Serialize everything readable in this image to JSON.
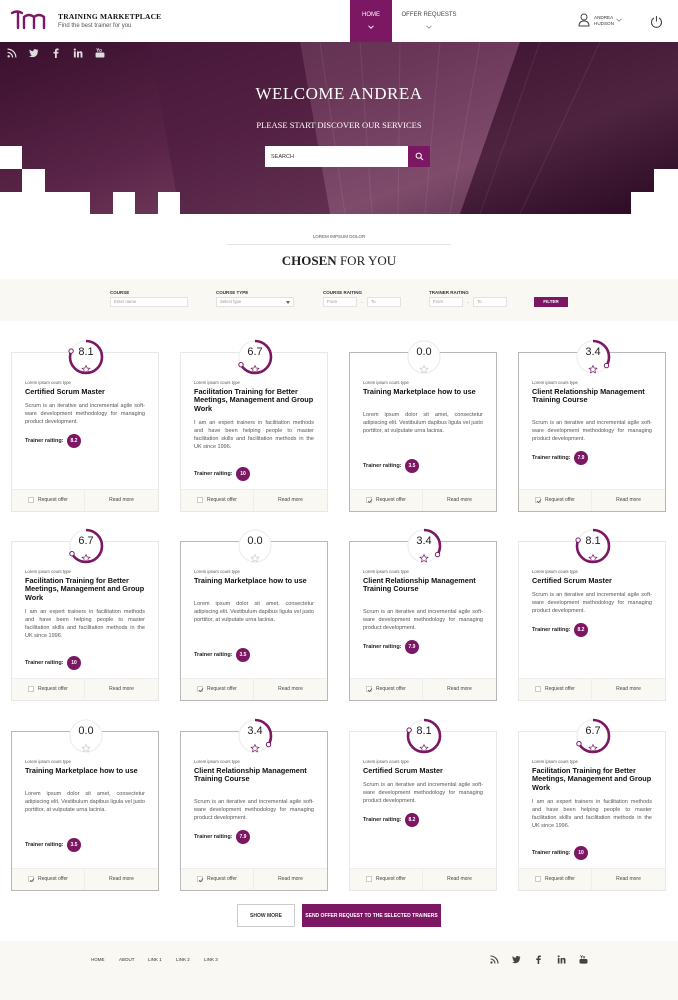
{
  "brand": {
    "title": "TRAINING MARKETPLACE",
    "subtitle": "Find the best trainer for you"
  },
  "nav": {
    "home": "HOME",
    "offers": "OFFER REQUESTS"
  },
  "user": {
    "first": "ANDREA",
    "last": "HUDSON"
  },
  "hero": {
    "welcome": "WELCOME ANDREA",
    "subtitle": "PLEASE START DISCOVER OUR SERVICES",
    "search_placeholder": "SEARCH"
  },
  "section": {
    "kicker": "LOREM IMPSUM DOLOR",
    "title_bold": "CHOSEN",
    "title_rest": " FOR YOU"
  },
  "filter": {
    "course_label": "COURSE",
    "course_placeholder": "Enter name",
    "type_label": "COURSE TYPE",
    "type_placeholder": "Select type",
    "rating_label": "COURSE RAITING",
    "rating_from": "From",
    "rating_to": "To",
    "trainer_label": "TRAINER RAITING",
    "trainer_from": "From",
    "trainer_to": "To",
    "button": "FILTER"
  },
  "card_labels": {
    "type": "Lorem ipsum cours type",
    "trainer": "Trainer raiting:",
    "request": "Request offer",
    "more": "Read more"
  },
  "cards": [
    {
      "score": "8.1",
      "fill": 0.81,
      "title": "Certified Scrum Master",
      "desc": "Scrum is an iterative and incremental agile soft-ware development methodology for managing product development.",
      "trainer": "8.2",
      "checked": false,
      "selected": false
    },
    {
      "score": "6.7",
      "fill": 0.67,
      "title": "Facilitation Training for Better Meetings, Management and Group Work",
      "desc": "I am an expert trainers in facilitation methods and have been helping people to master facilitation skills and facilitation methods in the UK since 1996.",
      "trainer": "10",
      "checked": false,
      "selected": false
    },
    {
      "score": "0.0",
      "fill": 0,
      "title": "Training Marketplace how to use",
      "desc": "Lorem ipsum dolor sit amet, consectetur adipiscing elit. Vestibulum dapibus ligula vel justo porttitor, at vulputate urna lacinia.",
      "trainer": "3.5",
      "checked": true,
      "selected": true
    },
    {
      "score": "3.4",
      "fill": 0.34,
      "title": "Client Relationship Management Training Course",
      "desc": "Scrum is an iterative and incremental agile soft-ware development methodology for managing product development.",
      "trainer": "7.9",
      "checked": true,
      "selected": true
    },
    {
      "score": "6.7",
      "fill": 0.67,
      "title": "Facilitation Training for Better Meetings, Management and Group Work",
      "desc": "I am an expert trainers in facilitation methods and have been helping people to master facilitation skills and facilitation methods in the UK since 1996.",
      "trainer": "10",
      "checked": false,
      "selected": false
    },
    {
      "score": "0.0",
      "fill": 0,
      "title": "Training Marketplace how to use",
      "desc": "Lorem ipsum dolor sit amet, consectetur adipiscing elit. Vestibulum dapibus ligula vel justo porttitor, at vulputate urna lacinia.",
      "trainer": "3.5",
      "checked": true,
      "selected": true
    },
    {
      "score": "3.4",
      "fill": 0.34,
      "title": "Client Relationship Management Training Course",
      "desc": "Scrum is an iterative and incremental agile soft-ware development methodology for managing product development.",
      "trainer": "7.9",
      "checked": true,
      "selected": true
    },
    {
      "score": "8.1",
      "fill": 0.81,
      "title": "Certified Scrum Master",
      "desc": "Scrum is an iterative and incremental agile soft-ware development methodology for managing product development.",
      "trainer": "8.2",
      "checked": false,
      "selected": false
    },
    {
      "score": "0.0",
      "fill": 0,
      "title": "Training Marketplace how to use",
      "desc": "Lorem ipsum dolor sit amet, consectetur adipiscing elit. Vestibulum dapibus ligula vel justo porttitor, at vulputate urna lacinia.",
      "trainer": "3.5",
      "checked": true,
      "selected": true
    },
    {
      "score": "3.4",
      "fill": 0.34,
      "title": "Client Relationship Management Training Course",
      "desc": "Scrum is an iterative and incremental agile soft-ware development methodology for managing product development.",
      "trainer": "7.9",
      "checked": true,
      "selected": true
    },
    {
      "score": "8.1",
      "fill": 0.81,
      "title": "Certified Scrum Master",
      "desc": "Scrum is an iterative and incremental agile soft-ware development methodology for managing product development.",
      "trainer": "8.2",
      "checked": false,
      "selected": false
    },
    {
      "score": "6.7",
      "fill": 0.67,
      "title": "Facilitation Training for Better Meetings, Management and Group Work",
      "desc": "I am an expert trainers in facilitation methods and have been helping people to master facilitation skills and facilitation methods in the UK since 1996.",
      "trainer": "10",
      "checked": false,
      "selected": false
    }
  ],
  "actions": {
    "show_more": "SHOW MORE",
    "send": "SEND OFFER REQUEST TO THE SELECTED TRAINERS"
  },
  "footer": {
    "links": [
      "HOME",
      "ABOUT",
      "LINK 1",
      "LINK 2",
      "LINK 3"
    ]
  },
  "colors": {
    "accent": "#7b1763",
    "panel": "#faf8f3"
  },
  "icons": [
    "rss-icon",
    "twitter-icon",
    "facebook-icon",
    "linkedin-icon",
    "youtube-icon",
    "search-icon",
    "user-icon",
    "power-icon",
    "chevron-down-icon",
    "star-icon",
    "check-icon"
  ]
}
